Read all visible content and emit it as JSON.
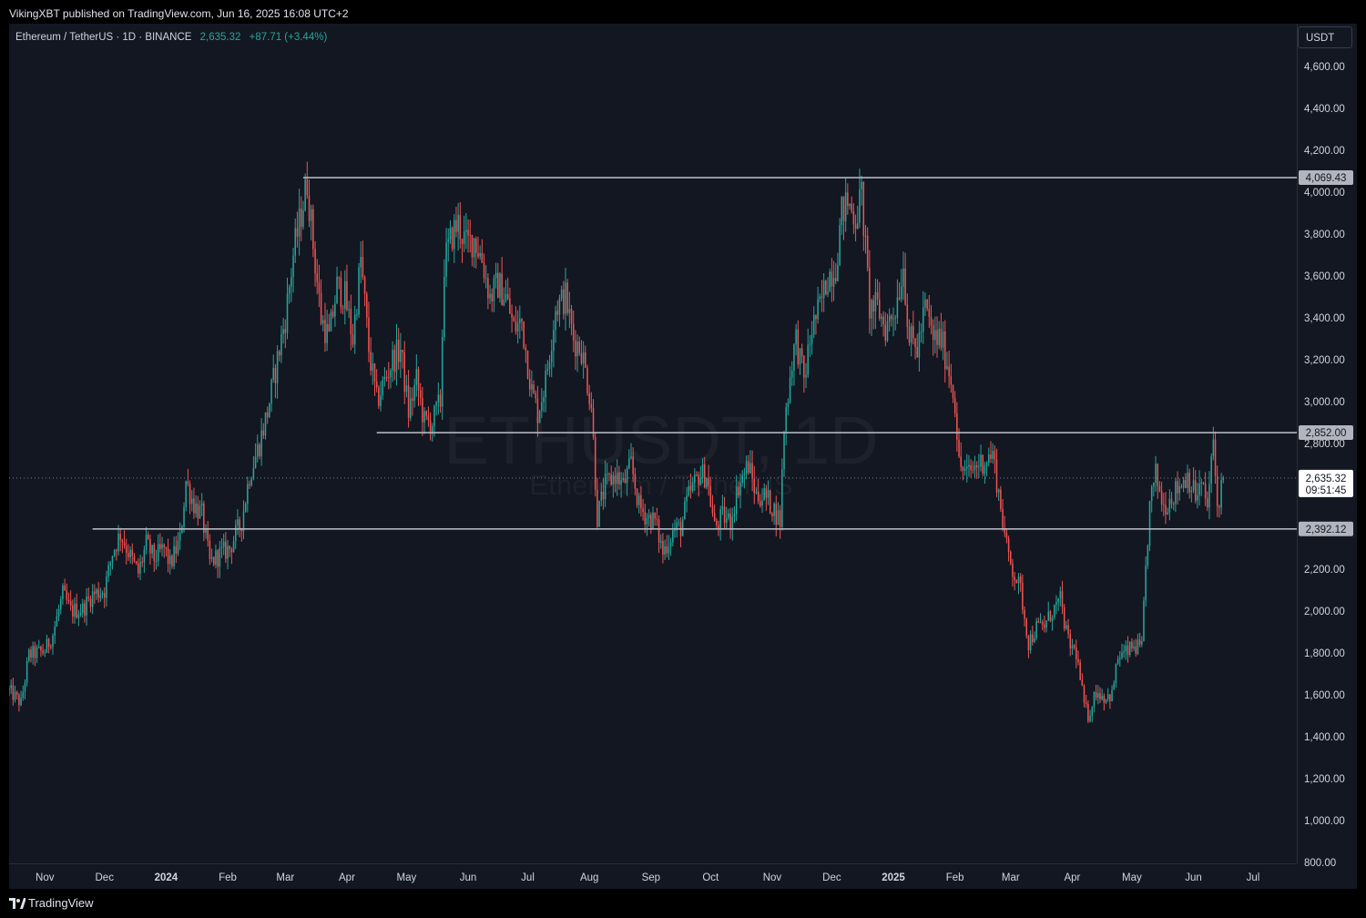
{
  "header": {
    "published": "VikingXBT published on TradingView.com, Jun 16, 2025 16:08 UTC+2"
  },
  "legend": {
    "symbol": "Ethereum / TetherUS · 1D · BINANCE",
    "price": "2,635.32",
    "change": "+87.71 (+3.44%)"
  },
  "currency_label": "USDT",
  "footer": {
    "brand": "TradingView"
  },
  "watermark": {
    "main": "ETHUSDT, 1D",
    "sub": "Ethereum / TetherUS"
  },
  "colors": {
    "up": "#26a69a",
    "down": "#ef5350",
    "background": "#131722",
    "level_line": "#b2b5be",
    "text": "#d1d4dc"
  },
  "chart_data": {
    "type": "candlestick",
    "ylim": [
      800,
      4700
    ],
    "yticks": [
      800,
      1000,
      1200,
      1400,
      1600,
      1800,
      2000,
      2200,
      2400,
      2600,
      2800,
      3000,
      3200,
      3400,
      3600,
      3800,
      4000,
      4200,
      4400,
      4600
    ],
    "ytick_labels": [
      "800.00",
      "1,000.00",
      "1,200.00",
      "1,400.00",
      "1,600.00",
      "1,800.00",
      "2,000.00",
      "2,200.00",
      "2,400.00",
      "2,600.00",
      "2,800.00",
      "3,000.00",
      "3,200.00",
      "3,400.00",
      "3,600.00",
      "3,800.00",
      "4,000.00",
      "4,200.00",
      "4,400.00",
      "4,600.00"
    ],
    "x_start": "2023-10-14",
    "x_end": "2025-07-23",
    "xticks": [
      {
        "label": "Nov",
        "date": "2023-11-01",
        "bold": false
      },
      {
        "label": "Dec",
        "date": "2023-12-01",
        "bold": false
      },
      {
        "label": "2024",
        "date": "2024-01-01",
        "bold": true
      },
      {
        "label": "Feb",
        "date": "2024-02-01",
        "bold": false
      },
      {
        "label": "Mar",
        "date": "2024-03-01",
        "bold": false
      },
      {
        "label": "Apr",
        "date": "2024-04-01",
        "bold": false
      },
      {
        "label": "May",
        "date": "2024-05-01",
        "bold": false
      },
      {
        "label": "Jun",
        "date": "2024-06-01",
        "bold": false
      },
      {
        "label": "Jul",
        "date": "2024-07-01",
        "bold": false
      },
      {
        "label": "Aug",
        "date": "2024-08-01",
        "bold": false
      },
      {
        "label": "Sep",
        "date": "2024-09-01",
        "bold": false
      },
      {
        "label": "Oct",
        "date": "2024-10-01",
        "bold": false
      },
      {
        "label": "Nov",
        "date": "2024-11-01",
        "bold": false
      },
      {
        "label": "Dec",
        "date": "2024-12-01",
        "bold": false
      },
      {
        "label": "2025",
        "date": "2025-01-01",
        "bold": true
      },
      {
        "label": "Feb",
        "date": "2025-02-01",
        "bold": false
      },
      {
        "label": "Mar",
        "date": "2025-03-01",
        "bold": false
      },
      {
        "label": "Apr",
        "date": "2025-04-01",
        "bold": false
      },
      {
        "label": "May",
        "date": "2025-05-01",
        "bold": false
      },
      {
        "label": "Jun",
        "date": "2025-06-01",
        "bold": false
      },
      {
        "label": "Jul",
        "date": "2025-07-01",
        "bold": false
      }
    ],
    "levels": [
      {
        "value": 4069.43,
        "label": "4,069.43",
        "from": "2024-03-10"
      },
      {
        "value": 2852.0,
        "label": "2,852.00",
        "from": "2024-04-16"
      },
      {
        "value": 2392.12,
        "label": "2,392.12",
        "from": "2023-11-25"
      }
    ],
    "last_price": {
      "value": 2635.32,
      "label": "2,635.32",
      "countdown": "09:51:45"
    },
    "candles_anchor": [
      [
        "2023-10-14",
        1620
      ],
      [
        "2023-10-20",
        1560
      ],
      [
        "2023-10-24",
        1790
      ],
      [
        "2023-11-01",
        1810
      ],
      [
        "2023-11-05",
        1890
      ],
      [
        "2023-11-10",
        2080
      ],
      [
        "2023-11-14",
        2000
      ],
      [
        "2023-11-20",
        2010
      ],
      [
        "2023-11-25",
        2080
      ],
      [
        "2023-12-01",
        2100
      ],
      [
        "2023-12-05",
        2280
      ],
      [
        "2023-12-09",
        2370
      ],
      [
        "2023-12-14",
        2260
      ],
      [
        "2023-12-18",
        2180
      ],
      [
        "2023-12-22",
        2320
      ],
      [
        "2023-12-26",
        2250
      ],
      [
        "2023-12-31",
        2300
      ],
      [
        "2024-01-03",
        2220
      ],
      [
        "2024-01-08",
        2340
      ],
      [
        "2024-01-11",
        2620
      ],
      [
        "2024-01-15",
        2510
      ],
      [
        "2024-01-19",
        2460
      ],
      [
        "2024-01-23",
        2230
      ],
      [
        "2024-01-28",
        2270
      ],
      [
        "2024-02-02",
        2300
      ],
      [
        "2024-02-08",
        2430
      ],
      [
        "2024-02-12",
        2650
      ],
      [
        "2024-02-17",
        2800
      ],
      [
        "2024-02-21",
        2950
      ],
      [
        "2024-02-26",
        3200
      ],
      [
        "2024-03-01",
        3400
      ],
      [
        "2024-03-05",
        3700
      ],
      [
        "2024-03-09",
        3900
      ],
      [
        "2024-03-12",
        4050
      ],
      [
        "2024-03-15",
        3750
      ],
      [
        "2024-03-19",
        3400
      ],
      [
        "2024-03-23",
        3300
      ],
      [
        "2024-03-27",
        3550
      ],
      [
        "2024-03-31",
        3500
      ],
      [
        "2024-04-04",
        3300
      ],
      [
        "2024-04-08",
        3680
      ],
      [
        "2024-04-12",
        3250
      ],
      [
        "2024-04-16",
        3000
      ],
      [
        "2024-04-20",
        3100
      ],
      [
        "2024-04-24",
        3200
      ],
      [
        "2024-04-28",
        3250
      ],
      [
        "2024-05-02",
        2950
      ],
      [
        "2024-05-06",
        3100
      ],
      [
        "2024-05-10",
        2900
      ],
      [
        "2024-05-14",
        2900
      ],
      [
        "2024-05-18",
        3000
      ],
      [
        "2024-05-20",
        3660
      ],
      [
        "2024-05-24",
        3800
      ],
      [
        "2024-05-27",
        3850
      ],
      [
        "2024-05-31",
        3750
      ],
      [
        "2024-06-04",
        3780
      ],
      [
        "2024-06-08",
        3680
      ],
      [
        "2024-06-12",
        3500
      ],
      [
        "2024-06-16",
        3560
      ],
      [
        "2024-06-20",
        3500
      ],
      [
        "2024-06-24",
        3350
      ],
      [
        "2024-06-28",
        3380
      ],
      [
        "2024-07-03",
        3050
      ],
      [
        "2024-07-06",
        2950
      ],
      [
        "2024-07-10",
        3100
      ],
      [
        "2024-07-15",
        3450
      ],
      [
        "2024-07-20",
        3500
      ],
      [
        "2024-07-24",
        3300
      ],
      [
        "2024-07-28",
        3250
      ],
      [
        "2024-08-02",
        2990
      ],
      [
        "2024-08-05",
        2450
      ],
      [
        "2024-08-09",
        2600
      ],
      [
        "2024-08-14",
        2650
      ],
      [
        "2024-08-18",
        2600
      ],
      [
        "2024-08-22",
        2700
      ],
      [
        "2024-08-26",
        2500
      ],
      [
        "2024-08-30",
        2450
      ],
      [
        "2024-09-03",
        2430
      ],
      [
        "2024-09-07",
        2280
      ],
      [
        "2024-09-12",
        2380
      ],
      [
        "2024-09-16",
        2400
      ],
      [
        "2024-09-20",
        2550
      ],
      [
        "2024-09-25",
        2650
      ],
      [
        "2024-09-29",
        2650
      ],
      [
        "2024-10-03",
        2400
      ],
      [
        "2024-10-07",
        2450
      ],
      [
        "2024-10-11",
        2430
      ],
      [
        "2024-10-15",
        2600
      ],
      [
        "2024-10-20",
        2700
      ],
      [
        "2024-10-24",
        2550
      ],
      [
        "2024-10-28",
        2550
      ],
      [
        "2024-11-01",
        2500
      ],
      [
        "2024-11-05",
        2430
      ],
      [
        "2024-11-07",
        2880
      ],
      [
        "2024-11-11",
        3200
      ],
      [
        "2024-11-13",
        3300
      ],
      [
        "2024-11-17",
        3100
      ],
      [
        "2024-11-21",
        3350
      ],
      [
        "2024-11-25",
        3450
      ],
      [
        "2024-11-29",
        3600
      ],
      [
        "2024-12-03",
        3650
      ],
      [
        "2024-12-06",
        3900
      ],
      [
        "2024-12-09",
        3950
      ],
      [
        "2024-12-13",
        3880
      ],
      [
        "2024-12-16",
        3990
      ],
      [
        "2024-12-20",
        3450
      ],
      [
        "2024-12-24",
        3450
      ],
      [
        "2024-12-28",
        3350
      ],
      [
        "2025-01-02",
        3450
      ],
      [
        "2025-01-06",
        3650
      ],
      [
        "2025-01-09",
        3300
      ],
      [
        "2025-01-13",
        3250
      ],
      [
        "2025-01-17",
        3450
      ],
      [
        "2025-01-21",
        3300
      ],
      [
        "2025-01-25",
        3300
      ],
      [
        "2025-01-29",
        3150
      ],
      [
        "2025-02-01",
        3000
      ],
      [
        "2025-02-03",
        2700
      ],
      [
        "2025-02-07",
        2650
      ],
      [
        "2025-02-12",
        2700
      ],
      [
        "2025-02-16",
        2720
      ],
      [
        "2025-02-20",
        2750
      ],
      [
        "2025-02-24",
        2500
      ],
      [
        "2025-02-27",
        2300
      ],
      [
        "2025-03-02",
        2200
      ],
      [
        "2025-03-06",
        2100
      ],
      [
        "2025-03-10",
        1850
      ],
      [
        "2025-03-14",
        1920
      ],
      [
        "2025-03-18",
        1930
      ],
      [
        "2025-03-22",
        2000
      ],
      [
        "2025-03-26",
        2050
      ],
      [
        "2025-03-30",
        1850
      ],
      [
        "2025-04-03",
        1800
      ],
      [
        "2025-04-07",
        1550
      ],
      [
        "2025-04-09",
        1500
      ],
      [
        "2025-04-13",
        1620
      ],
      [
        "2025-04-17",
        1590
      ],
      [
        "2025-04-21",
        1600
      ],
      [
        "2025-04-24",
        1780
      ],
      [
        "2025-04-28",
        1800
      ],
      [
        "2025-05-02",
        1830
      ],
      [
        "2025-05-06",
        1820
      ],
      [
        "2025-05-08",
        2200
      ],
      [
        "2025-05-10",
        2500
      ],
      [
        "2025-05-13",
        2650
      ],
      [
        "2025-05-17",
        2500
      ],
      [
        "2025-05-21",
        2550
      ],
      [
        "2025-05-25",
        2600
      ],
      [
        "2025-05-29",
        2650
      ],
      [
        "2025-06-02",
        2550
      ],
      [
        "2025-06-05",
        2600
      ],
      [
        "2025-06-08",
        2500
      ],
      [
        "2025-06-11",
        2800
      ],
      [
        "2025-06-13",
        2500
      ],
      [
        "2025-06-16",
        2635
      ]
    ]
  }
}
